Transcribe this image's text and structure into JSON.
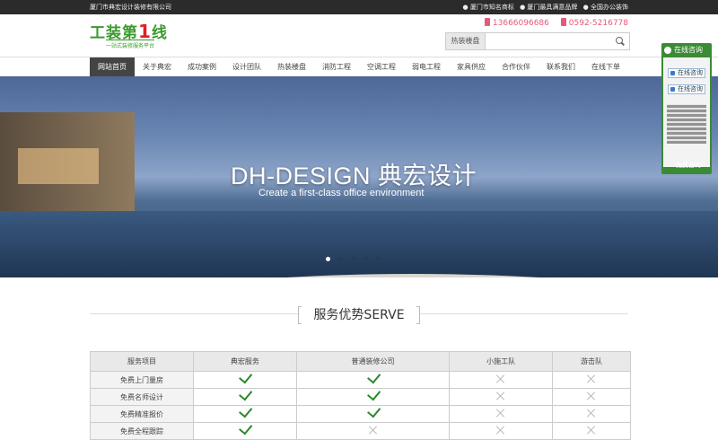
{
  "topbar": {
    "company": "厦门市典宏设计装修有限公司",
    "badges": [
      "● 厦门市知名商标",
      "● 厦门最具满意品牌",
      "● 全国办公装饰"
    ]
  },
  "header": {
    "logo_text_a": "工装第",
    "logo_text_num": "1",
    "logo_text_b": "线",
    "logo_sub": "一站式装修服务平台",
    "phone_mobile": "13666096686",
    "phone_tel": "0592-5216778",
    "search_hot_label": "热装楼盘",
    "search_placeholder": ""
  },
  "nav": {
    "items": [
      "网站首页",
      "关于典宏",
      "成功案例",
      "设计团队",
      "热装楼盘",
      "消防工程",
      "空调工程",
      "弱电工程",
      "家具供应",
      "合作伙伴",
      "联系我们",
      "在线下单"
    ],
    "active_index": 0
  },
  "banner": {
    "title": "DH-DESIGN 典宏设计",
    "subtitle": "Create a first-class office environment",
    "slide_count": 5,
    "active_slide": 0
  },
  "float_panel": {
    "header": "在线咨询",
    "qq_labels": [
      "在线咨询",
      "在线咨询"
    ],
    "footer": "免费咨询"
  },
  "section": {
    "title": "服务优势SERVE"
  },
  "compare_table": {
    "headers": [
      "服务项目",
      "典宏服务",
      "普通装修公司",
      "小施工队",
      "游击队"
    ],
    "rows": [
      {
        "label": "免费上门量房",
        "marks": [
          "check",
          "check",
          "cross",
          "cross"
        ]
      },
      {
        "label": "免费名师设计",
        "marks": [
          "check",
          "check",
          "cross",
          "cross"
        ]
      },
      {
        "label": "免费精准报价",
        "marks": [
          "check",
          "check",
          "cross",
          "cross"
        ]
      },
      {
        "label": "免费全程跟踪",
        "marks": [
          "check",
          "cross",
          "cross",
          "cross"
        ]
      }
    ]
  }
}
